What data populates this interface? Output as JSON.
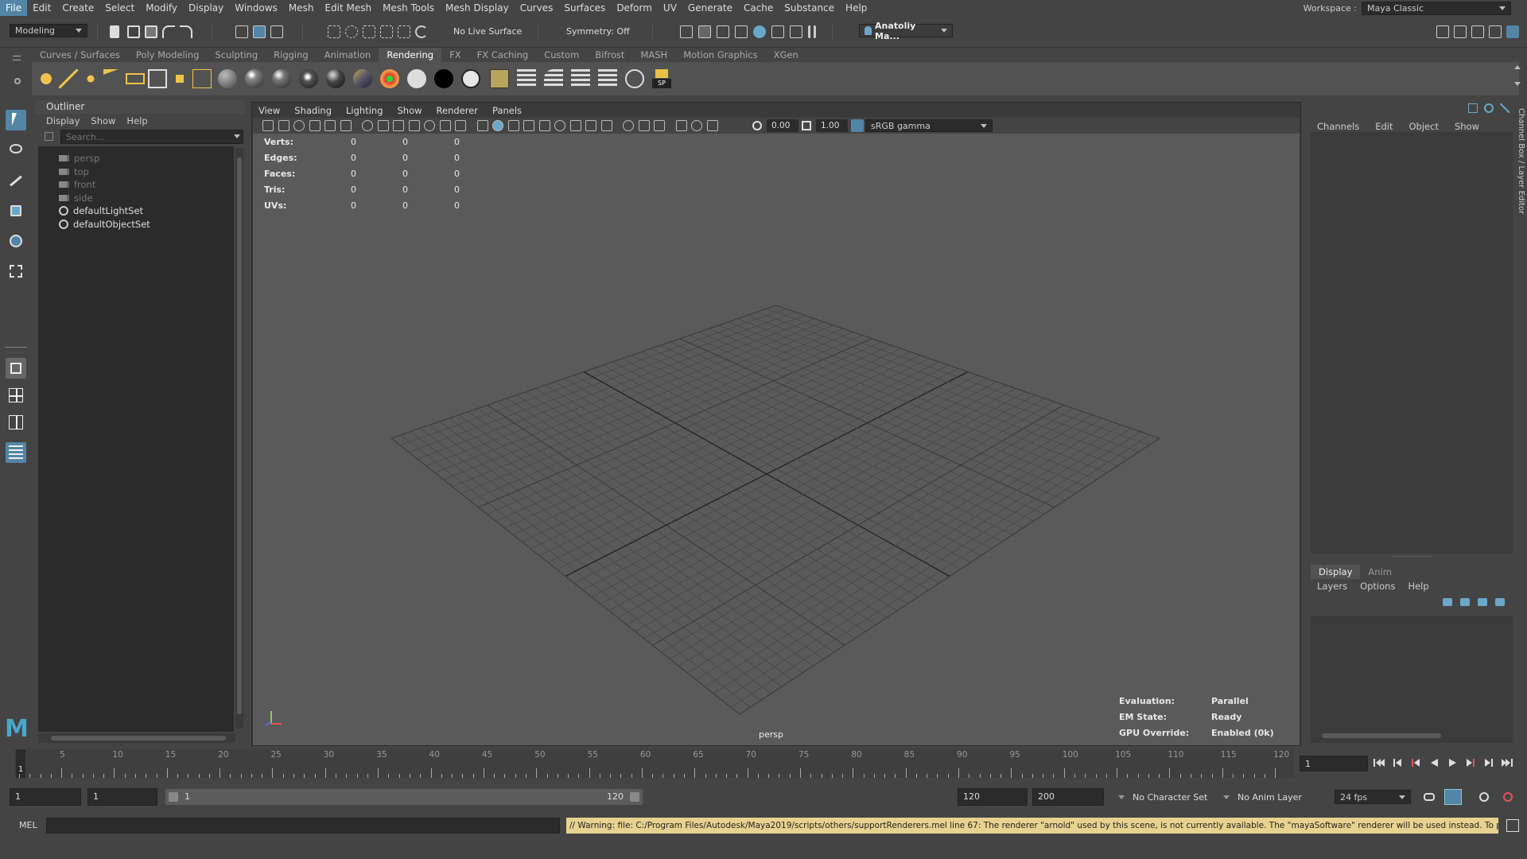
{
  "menubar": {
    "items": [
      "File",
      "Edit",
      "Create",
      "Select",
      "Modify",
      "Display",
      "Windows",
      "Mesh",
      "Edit Mesh",
      "Mesh Tools",
      "Mesh Display",
      "Curves",
      "Surfaces",
      "Deform",
      "UV",
      "Generate",
      "Cache",
      "Substance",
      "Help"
    ],
    "workspace_label": "Workspace :",
    "workspace_value": "Maya Classic"
  },
  "statusline": {
    "mode": "Modeling",
    "live_surface": "No Live Surface",
    "symmetry": "Symmetry: Off",
    "user": "Anatoliy Ma..."
  },
  "shelf": {
    "tabs": [
      "Curves / Surfaces",
      "Poly Modeling",
      "Sculpting",
      "Rigging",
      "Animation",
      "Rendering",
      "FX",
      "FX Caching",
      "Custom",
      "Bifrost",
      "MASH",
      "Motion Graphics",
      "XGen"
    ],
    "active_tab": "Rendering",
    "sp_label": "SP"
  },
  "outliner": {
    "title": "Outliner",
    "menu": [
      "Display",
      "Show",
      "Help"
    ],
    "search_placeholder": "Search...",
    "items": [
      {
        "label": "persp",
        "icon": "camera-icon"
      },
      {
        "label": "top",
        "icon": "camera-icon"
      },
      {
        "label": "front",
        "icon": "camera-icon"
      },
      {
        "label": "side",
        "icon": "camera-icon"
      },
      {
        "label": "defaultLightSet",
        "icon": "set-icon"
      },
      {
        "label": "defaultObjectSet",
        "icon": "set-icon"
      }
    ]
  },
  "viewport": {
    "menu": [
      "View",
      "Shading",
      "Lighting",
      "Show",
      "Renderer",
      "Panels"
    ],
    "exposure": "0.00",
    "gamma": "1.00",
    "colorspace": "sRGB gamma",
    "hud": [
      {
        "label": "Verts:",
        "v1": "0",
        "v2": "0",
        "v3": "0"
      },
      {
        "label": "Edges:",
        "v1": "0",
        "v2": "0",
        "v3": "0"
      },
      {
        "label": "Faces:",
        "v1": "0",
        "v2": "0",
        "v3": "0"
      },
      {
        "label": "Tris:",
        "v1": "0",
        "v2": "0",
        "v3": "0"
      },
      {
        "label": "UVs:",
        "v1": "0",
        "v2": "0",
        "v3": "0"
      }
    ],
    "eval": [
      {
        "label": "Evaluation:",
        "value": "Parallel"
      },
      {
        "label": "EM State:",
        "value": "Ready"
      },
      {
        "label": "GPU Override:",
        "value": "Enabled (0k)"
      }
    ],
    "camera_label": "persp"
  },
  "channelbox": {
    "menu": [
      "Channels",
      "Edit",
      "Object",
      "Show"
    ],
    "side_tab": "Channel Box / Layer Editor",
    "layer_tabs": [
      "Display",
      "Anim"
    ],
    "layer_menu": [
      "Layers",
      "Options",
      "Help"
    ]
  },
  "timeslider": {
    "ticks": [
      "5",
      "10",
      "15",
      "20",
      "25",
      "30",
      "35",
      "40",
      "45",
      "50",
      "55",
      "60",
      "65",
      "70",
      "75",
      "80",
      "85",
      "90",
      "95",
      "100",
      "105",
      "110",
      "115",
      "120"
    ],
    "current_frame_marker": "1",
    "current_frame_field": "1"
  },
  "range": {
    "start": "1",
    "anim_start": "1",
    "range_inner_start": "1",
    "range_inner_end": "120",
    "anim_end": "120",
    "end": "200",
    "character_set": "No Character Set",
    "anim_layer": "No Anim Layer",
    "fps": "24 fps"
  },
  "cmdline": {
    "lang": "MEL",
    "warning": "// Warning: file: C:/Program Files/Autodesk/Maya2019/scripts/others/supportRenderers.mel line 67: The renderer \"arnold\" used by this scene, is not currently available. The \"mayaSoftware\" renderer will be used instead. To prevent"
  },
  "colors": {
    "accent": "#5285a6",
    "warning_bg": "#e8d28f"
  }
}
